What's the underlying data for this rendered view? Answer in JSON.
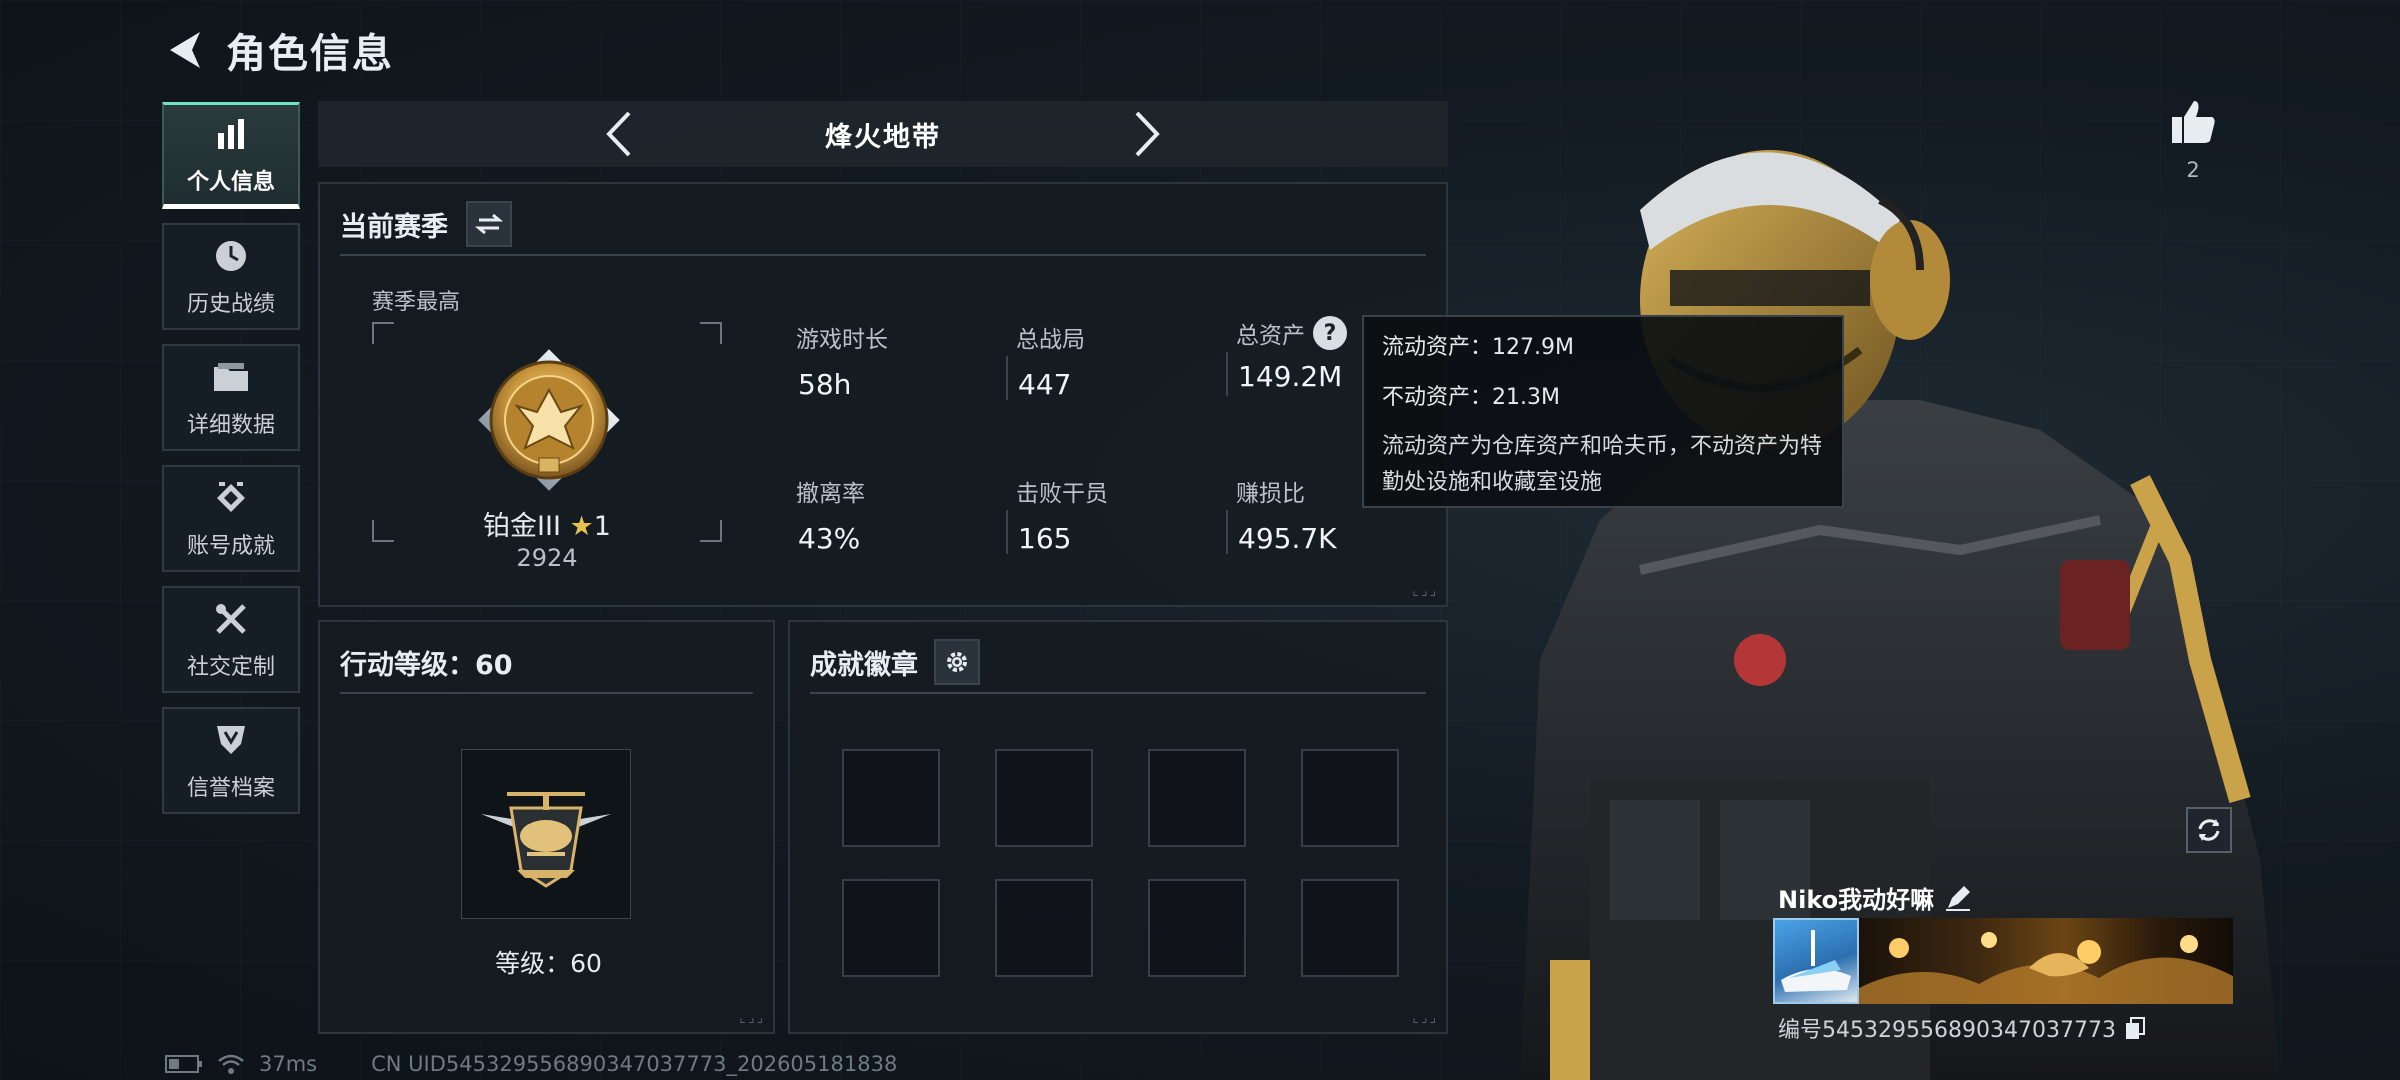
{
  "header": {
    "title": "角色信息"
  },
  "sidebar": {
    "items": [
      {
        "label": "个人信息",
        "icon": "bar-chart-icon",
        "active": true
      },
      {
        "label": "历史战绩",
        "icon": "clock-icon",
        "active": false
      },
      {
        "label": "详细数据",
        "icon": "folder-icon",
        "active": false
      },
      {
        "label": "账号成就",
        "icon": "achievement-icon",
        "active": false
      },
      {
        "label": "社交定制",
        "icon": "tools-icon",
        "active": false
      },
      {
        "label": "信誉档案",
        "icon": "shield-icon",
        "active": false
      }
    ]
  },
  "mode": {
    "title": "烽火地带"
  },
  "season": {
    "title": "当前赛季",
    "best_label": "赛季最高",
    "rank_name": "铂金III",
    "rank_stars": "1",
    "rank_points": "2924",
    "stats": [
      {
        "label": "游戏时长",
        "value": "58h"
      },
      {
        "label": "总战局",
        "value": "447"
      },
      {
        "label": "总资产",
        "value": "149.2M"
      },
      {
        "label": "撤离率",
        "value": "43%"
      },
      {
        "label": "击败干员",
        "value": "165"
      },
      {
        "label": "赚损比",
        "value": "495.7K"
      }
    ],
    "corner": "⌞⌟⌟"
  },
  "tooltip": {
    "liquid": "流动资产：127.9M",
    "fixed": "不动资产：21.3M",
    "desc": "流动资产为仓库资产和哈夫币，不动资产为特勤处设施和收藏室设施"
  },
  "level": {
    "title": "行动等级：60",
    "text": "等级：60"
  },
  "badges": {
    "title": "成就徽章",
    "slots": 8
  },
  "profile": {
    "likes": "2",
    "name": "Niko我动好嘛",
    "id": "编号545329556890347037773"
  },
  "status": {
    "ping": "37ms",
    "uid": "CN UID545329556890347037773_202605181838"
  },
  "colors": {
    "accent": "#6fe3c3",
    "background": "#131b22",
    "gold": "#c9a24a"
  }
}
